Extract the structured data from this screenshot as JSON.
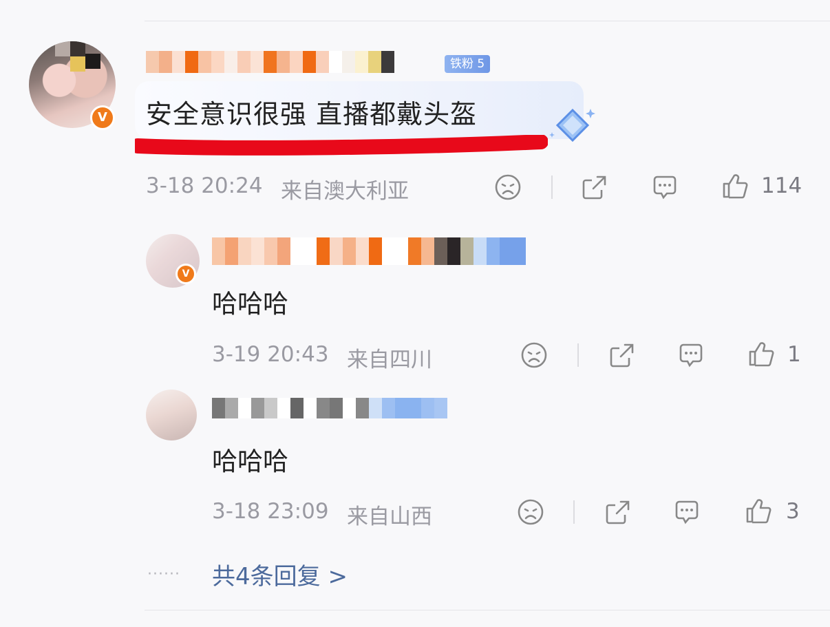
{
  "comment": {
    "text": "安全意识很强 直播都戴头盔",
    "fan_badge": "铁粉 5",
    "time": "3-18 20:24",
    "location": "来自澳大利亚",
    "likes": "114"
  },
  "replies": [
    {
      "text": "哈哈哈",
      "time": "3-19 20:43",
      "location": "来自四川",
      "likes": "1"
    },
    {
      "text": "哈哈哈",
      "time": "3-18 23:09",
      "location": "来自山西",
      "likes": "3"
    }
  ],
  "more_replies": {
    "dots": "······",
    "label": "共4条回复 >"
  },
  "icons": {
    "verified": "V",
    "dislike": "sad-face-icon",
    "share": "share-icon",
    "comment": "comment-icon",
    "like": "thumbs-up-icon"
  },
  "colors": {
    "verified_orange": "#f07a1a",
    "link_blue": "#4c6a9c",
    "highlight_red": "#e8091a"
  }
}
